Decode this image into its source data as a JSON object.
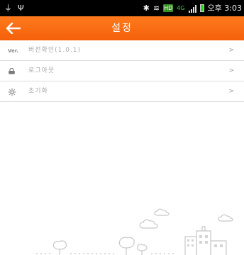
{
  "status_bar": {
    "time": "오후 3:03",
    "network": "4G",
    "icons": [
      "usb-icon",
      "bluetooth-icon",
      "wifi-icon",
      "hd-icon",
      "signal-icon",
      "battery-icon"
    ]
  },
  "header": {
    "title": "설정",
    "back_icon": "arrow-left-icon"
  },
  "menu": {
    "items": [
      {
        "icon_text": "Ver.",
        "label": "버전확인(1.0.1)",
        "chevron": ">"
      },
      {
        "icon": "lock-icon",
        "label": "로그아웃",
        "chevron": ">"
      },
      {
        "icon": "sparkle-icon",
        "label": "초기화",
        "chevron": ">"
      }
    ]
  },
  "colors": {
    "header": "#f4600a",
    "divider": "#dcdcdc",
    "text_muted": "#a8a8a8"
  }
}
